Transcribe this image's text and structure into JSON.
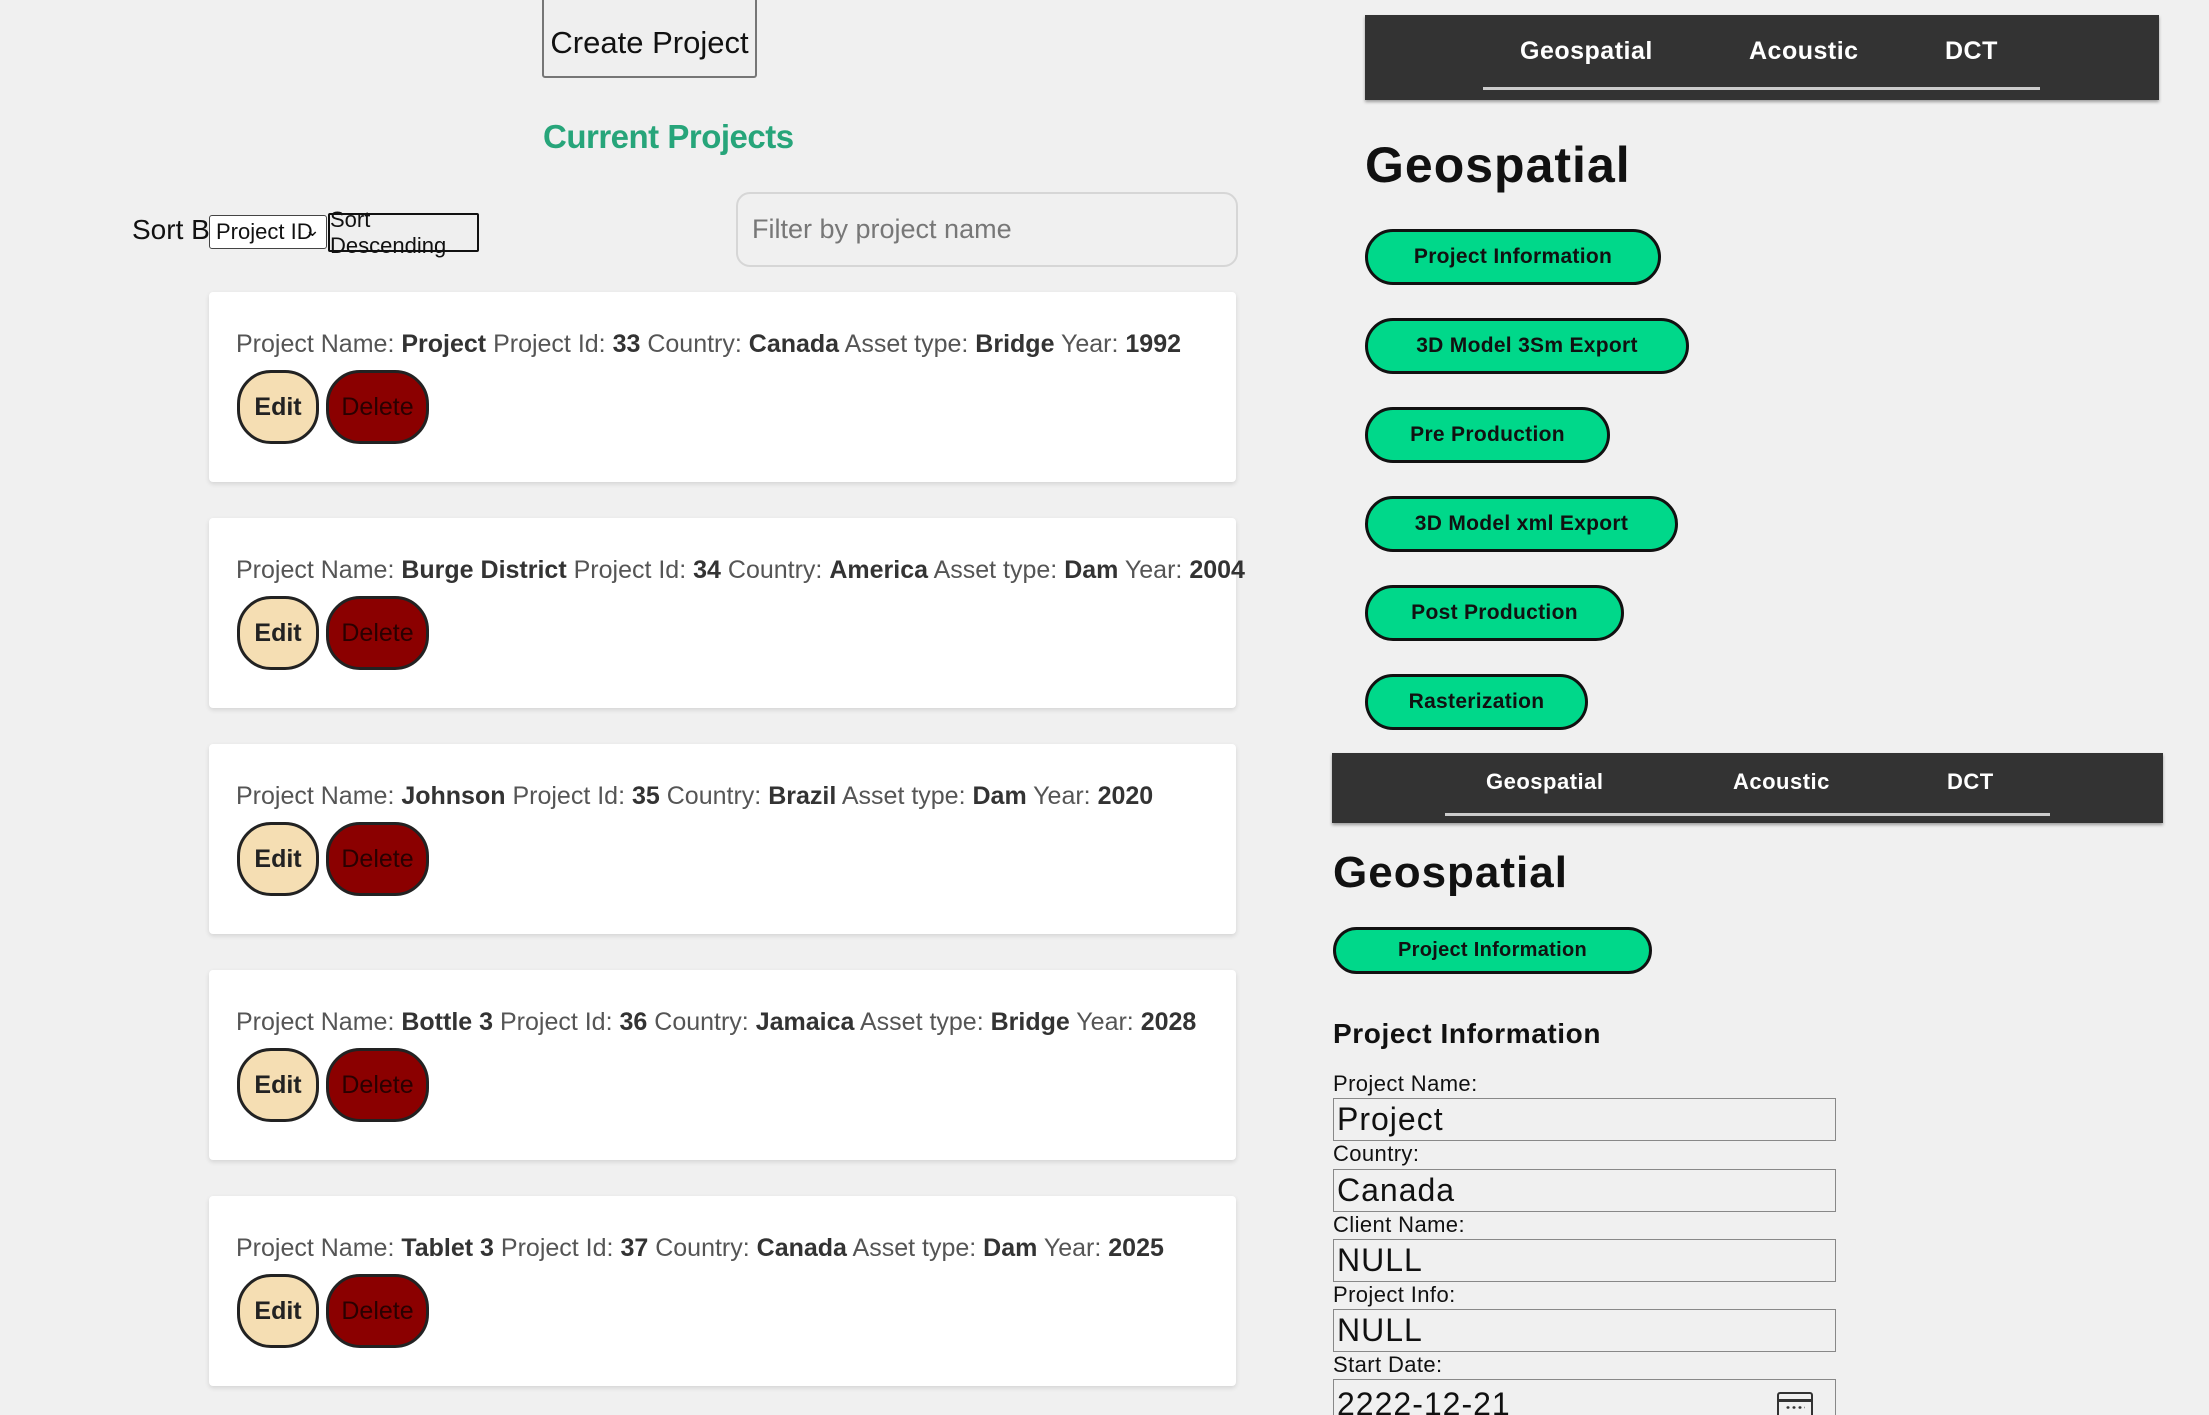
{
  "left": {
    "create_button": "Create Project",
    "section_title": "Current Projects",
    "sort": {
      "label": "Sort By:",
      "selected": "Project ID",
      "order_button": "Sort Descending"
    },
    "filter": {
      "placeholder": "Filter by project name"
    },
    "labels": {
      "name": "Project Name:",
      "id": "Project Id:",
      "country": "Country:",
      "asset": "Asset type:",
      "year": "Year:"
    },
    "edit_label": "Edit",
    "delete_label": "Delete",
    "projects": [
      {
        "name": "Project",
        "id": "33",
        "country": "Canada",
        "asset": "Bridge",
        "year": "1992"
      },
      {
        "name": "Burge District",
        "id": "34",
        "country": "America",
        "asset": "Dam",
        "year": "2004"
      },
      {
        "name": "Johnson",
        "id": "35",
        "country": "Brazil",
        "asset": "Dam",
        "year": "2020"
      },
      {
        "name": "Bottle 3",
        "id": "36",
        "country": "Jamaica",
        "asset": "Bridge",
        "year": "2028"
      },
      {
        "name": "Tablet 3",
        "id": "37",
        "country": "Canada",
        "asset": "Dam",
        "year": "2025"
      }
    ]
  },
  "right": {
    "nav_tabs": [
      "Geospatial",
      "Acoustic",
      "DCT"
    ],
    "panel_title": "Geospatial",
    "buttons": [
      "Project Information",
      "3D Model 3Sm Export",
      "Pre Production",
      "3D Model xml Export",
      "Post Production",
      "Rasterization"
    ],
    "second_panel": {
      "nav_tabs": [
        "Geospatial",
        "Acoustic",
        "DCT"
      ],
      "title": "Geospatial",
      "button": "Project Information",
      "form_title": "Project Information",
      "fields": [
        {
          "label": "Project Name:",
          "value": "Project"
        },
        {
          "label": "Country:",
          "value": "Canada"
        },
        {
          "label": "Client Name:",
          "value": "NULL"
        },
        {
          "label": "Project Info:",
          "value": "NULL"
        },
        {
          "label": "Start Date:",
          "value": "2222-12-21"
        }
      ]
    }
  },
  "colors": {
    "accent_green": "#27a57a",
    "pill_green": "#00d88a",
    "nav_bg": "#333333",
    "edit_bg": "#f5deb3",
    "delete_bg": "#8b0000"
  }
}
